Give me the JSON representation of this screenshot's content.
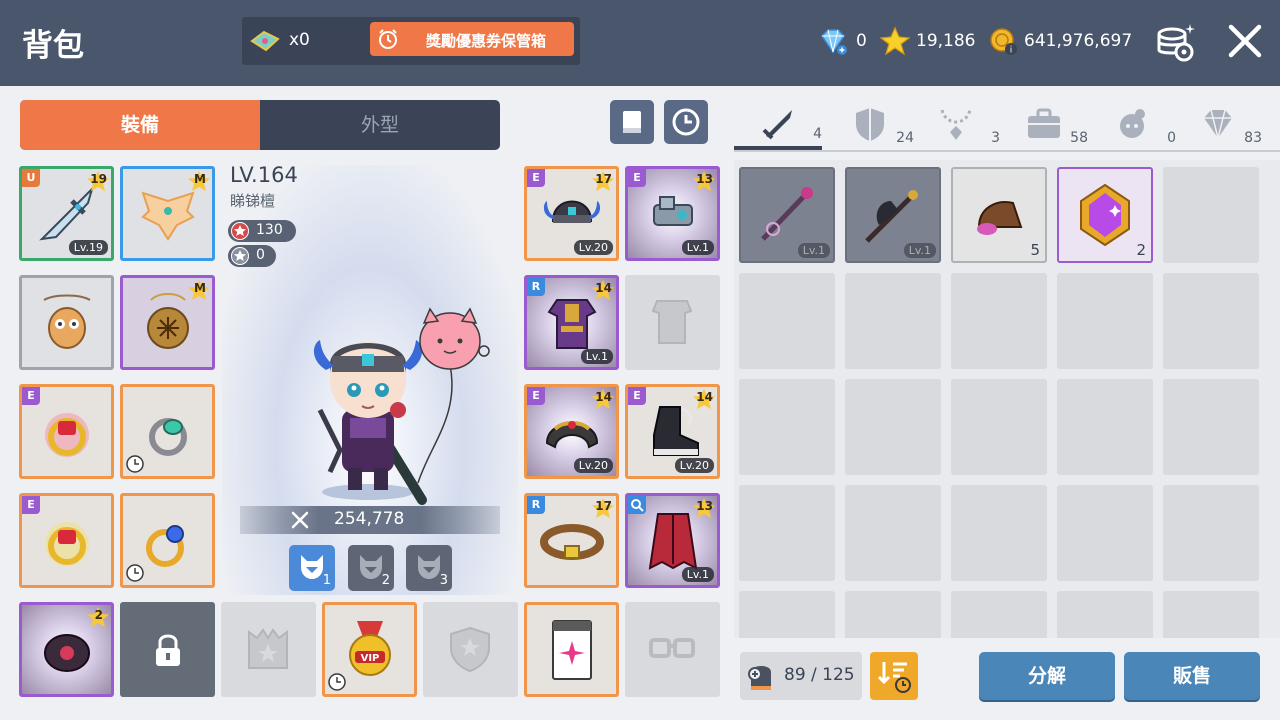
{
  "header": {
    "title": "背包",
    "ticket_count": "x0",
    "reward_label": "獎勵優惠券保管箱",
    "diamond": "0",
    "star_points": "19,186",
    "mesos": "641,976,697"
  },
  "tabs": {
    "equip": "裝備",
    "appearance": "外型"
  },
  "character": {
    "level": "LV.164",
    "name": "睇锑檀",
    "stat_red": "130",
    "stat_gray": "0",
    "power": "254,778",
    "presets": [
      "1",
      "2",
      "3"
    ]
  },
  "equip_left": [
    {
      "grade": "U",
      "stars": "19",
      "lv": "Lv.19"
    },
    {
      "grade": "",
      "stars": "M",
      "lv": ""
    },
    {
      "grade": "",
      "stars": "",
      "lv": ""
    },
    {
      "grade": "",
      "stars": "M",
      "lv": ""
    },
    {
      "grade": "E",
      "stars": "",
      "lv": ""
    },
    {
      "grade": "",
      "stars": "",
      "lv": ""
    },
    {
      "grade": "E",
      "stars": "",
      "lv": ""
    },
    {
      "grade": "",
      "stars": "",
      "lv": ""
    }
  ],
  "equip_right": [
    {
      "grade": "E",
      "stars": "17",
      "lv": "Lv.20"
    },
    {
      "grade": "E",
      "stars": "13",
      "lv": "Lv.1"
    },
    {
      "grade": "R",
      "stars": "14",
      "lv": "Lv.1"
    },
    {
      "grade": "E",
      "stars": "14",
      "lv": "Lv.20"
    },
    {
      "grade": "E",
      "stars": "14",
      "lv": "Lv.20"
    },
    {
      "grade": "R",
      "stars": "17",
      "lv": ""
    },
    {
      "grade": "Q",
      "stars": "13",
      "lv": "Lv.1"
    }
  ],
  "equip_bottom": [
    {
      "stars": "2"
    }
  ],
  "categories": [
    {
      "icon": "sword-icon",
      "count": "4"
    },
    {
      "icon": "shield-icon",
      "count": "24"
    },
    {
      "icon": "necklace-icon",
      "count": "3"
    },
    {
      "icon": "briefcase-icon",
      "count": "58"
    },
    {
      "icon": "pet-icon",
      "count": "0"
    },
    {
      "icon": "gem-icon",
      "count": "83"
    }
  ],
  "inventory_items": [
    {
      "type": "staff",
      "lv": "Lv.1",
      "qty": ""
    },
    {
      "type": "axe",
      "lv": "Lv.1",
      "qty": ""
    },
    {
      "type": "pouch",
      "lv": "",
      "qty": "5"
    },
    {
      "type": "crystal",
      "lv": "",
      "qty": "2"
    }
  ],
  "capacity": "89 / 125",
  "buttons": {
    "disassemble": "分解",
    "sell": "販售"
  }
}
